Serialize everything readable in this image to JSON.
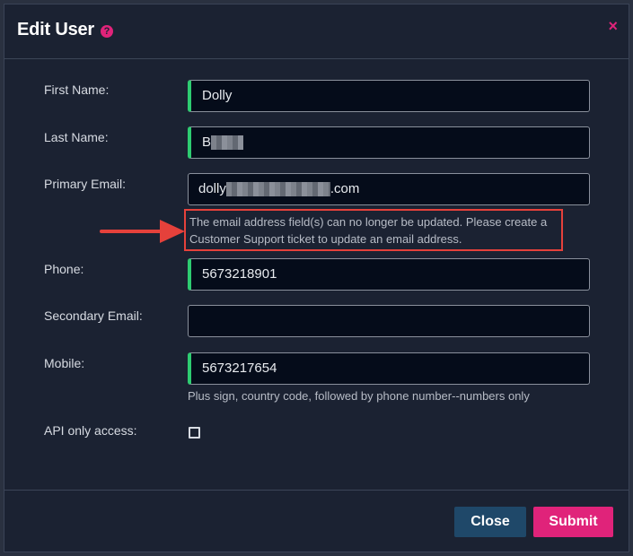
{
  "dialog": {
    "title": "Edit User",
    "help_icon": "question-circle-icon",
    "close_icon": "close-x-icon",
    "close_glyph": "×"
  },
  "form": {
    "first_name": {
      "label": "First Name:",
      "value": "Dolly"
    },
    "last_name": {
      "label": "Last Name:",
      "value_prefix": "B"
    },
    "primary_email": {
      "label": "Primary Email:",
      "value_prefix": "dolly",
      "value_suffix": ".com",
      "notice": "The email address field(s) can no longer be updated. Please create a Customer Support ticket to update an email address."
    },
    "phone": {
      "label": "Phone:",
      "value": "5673218901"
    },
    "secondary_email": {
      "label": "Secondary Email:",
      "value": ""
    },
    "mobile": {
      "label": "Mobile:",
      "value": "5673217654",
      "help": "Plus sign, country code, followed by phone number--numbers only"
    },
    "api_only": {
      "label": "API only access:"
    }
  },
  "buttons": {
    "close": "Close",
    "submit": "Submit"
  },
  "colors": {
    "accent": "#e0237a",
    "required_marker": "#2ecc71",
    "annotation": "#e5413b",
    "close_button": "#1f4869"
  }
}
